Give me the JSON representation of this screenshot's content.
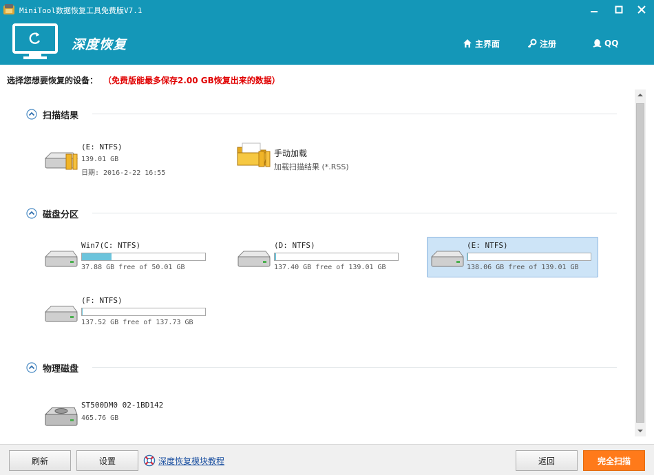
{
  "window": {
    "title": "MiniTool数据恢复工具免费版V7.1",
    "controls": [
      "minimize-icon",
      "maximize-icon",
      "close-icon"
    ]
  },
  "header": {
    "brand": "深度恢复",
    "nav": [
      {
        "label": "主界面",
        "icon": "home-icon"
      },
      {
        "label": "注册",
        "icon": "key-icon"
      },
      {
        "label": "QQ",
        "icon": "qq-icon"
      }
    ]
  },
  "instruction": {
    "text": "选择您想要恢复的设备：",
    "warning": "（免费版能最多保存2.00 GB恢复出来的数据）"
  },
  "sections": {
    "scan_results": {
      "title": "扫描结果",
      "items": [
        {
          "name": "(E: NTFS)",
          "size": "139.01 GB",
          "date": "日期: 2016-2-22 16:55"
        },
        {
          "name": "手动加载",
          "desc": "加载扫描结果 (*.RSS)"
        }
      ]
    },
    "partitions": {
      "title": "磁盘分区",
      "items": [
        {
          "name": "Win7(C: NTFS)",
          "free": "37.88 GB free of 50.01 GB",
          "used_fraction": 0.243
        },
        {
          "name": "(D: NTFS)",
          "free": "137.40 GB free of 139.01 GB",
          "used_fraction": 0.012
        },
        {
          "name": "(E: NTFS)",
          "free": "138.06 GB free of 139.01 GB",
          "used_fraction": 0.007,
          "selected": true
        },
        {
          "name": "(F: NTFS)",
          "free": "137.52 GB free of 137.73 GB",
          "used_fraction": 0.002
        }
      ]
    },
    "physical": {
      "title": "物理磁盘",
      "items": [
        {
          "name": "ST500DM0 02-1BD142",
          "size": "465.76 GB"
        }
      ]
    }
  },
  "footer": {
    "refresh": "刷新",
    "settings": "设置",
    "tutorial": "深度恢复模块教程",
    "back": "返回",
    "full_scan": "完全扫描"
  },
  "colors": {
    "header_bg": "#1497b8",
    "warning": "#e00000",
    "primary_button": "#ff7a1a",
    "selected_bg": "#cde4f7",
    "usage_fill": "#6cc4dc"
  }
}
